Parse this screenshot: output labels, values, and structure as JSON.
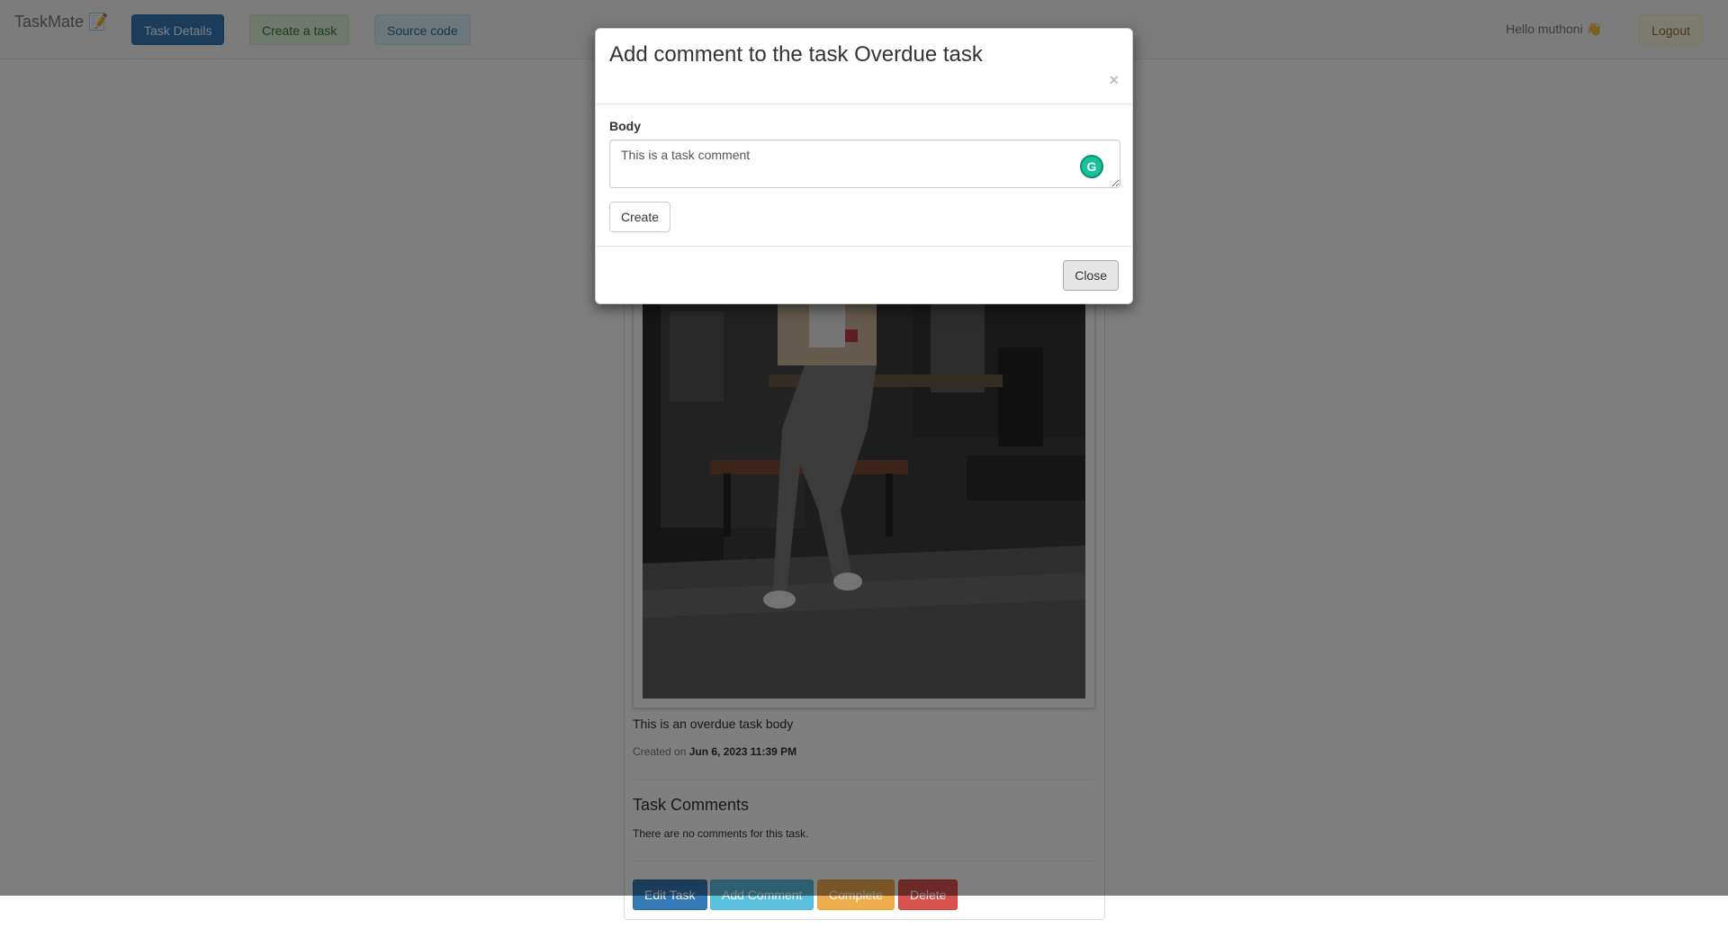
{
  "navbar": {
    "brand": "TaskMate 📝",
    "items": [
      {
        "label": "Task Details"
      },
      {
        "label": "Create a task"
      },
      {
        "label": "Source code"
      }
    ],
    "greeting": "Hello muthoni 👋",
    "logout_label": "Logout"
  },
  "task": {
    "body": "This is an overdue task body",
    "created_prefix": "Created on",
    "created_date": "Jun 6, 2023 11:39 PM",
    "comments_heading": "Task Comments",
    "no_comments": "There are no comments for this task.",
    "actions": {
      "edit": "Edit Task",
      "add_comment": "Add Comment",
      "complete": "Complete",
      "delete": "Delete"
    }
  },
  "modal": {
    "title": "Add comment to the task Overdue task",
    "close_symbol": "×",
    "body_label": "Body",
    "body_value": "This is a task comment",
    "create_label": "Create",
    "close_label": "Close"
  },
  "colors": {
    "primary": "#337ab7",
    "info": "#5bc0de",
    "warning": "#f0ad4e",
    "danger": "#d9534f",
    "grammarly": "#15c39a"
  },
  "icons": {
    "grammarly": "grammarly-icon"
  }
}
